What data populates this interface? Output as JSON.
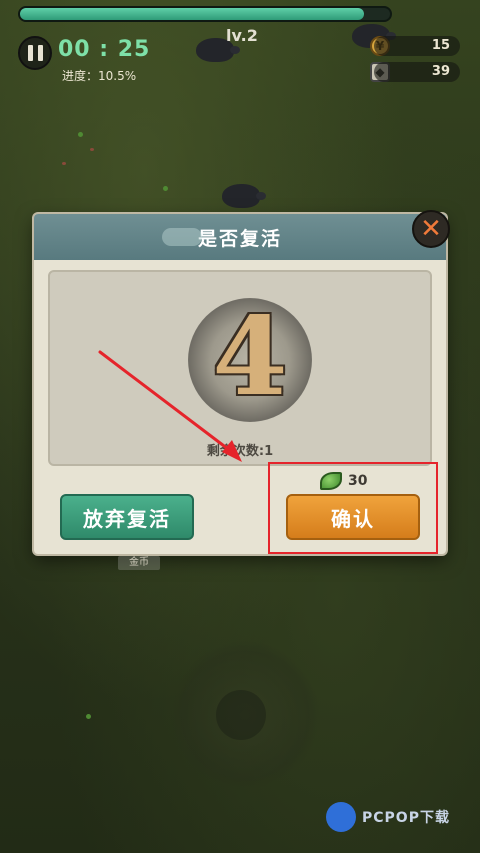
{
  "hud": {
    "timer": "00 : 25",
    "progress": "进度：10.5%",
    "level": "lv.2",
    "coins": "15",
    "kills": "39",
    "hp_fraction": 0.93
  },
  "dialog": {
    "title": "是否复活",
    "revive_number": "4",
    "remaining_text": "剩余次数:1",
    "cost_value": "30",
    "giveup_label": "放弃复活",
    "confirm_label": "确认",
    "close_symbol": "✕"
  },
  "below_dialog_label": "金币",
  "watermark": "PCPOP下载",
  "icons": {
    "pause": "pause-icon",
    "coin": "coin-icon",
    "kills": "boar-head-icon",
    "leaf": "leaf-icon",
    "close": "close-icon"
  },
  "colors": {
    "accent_green": "#3da17f",
    "accent_orange": "#e08a24",
    "highlight_red": "#e5242b"
  }
}
